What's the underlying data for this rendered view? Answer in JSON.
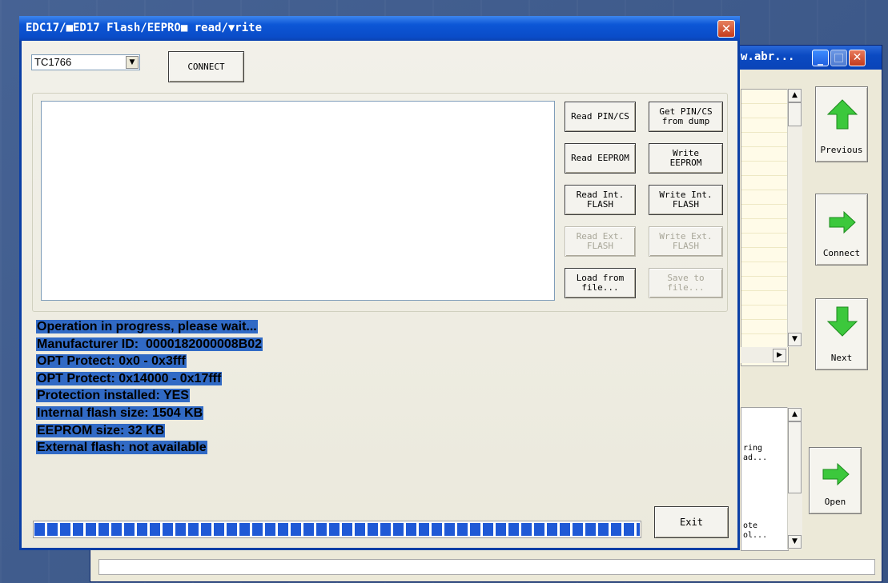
{
  "dialog": {
    "title": "EDC17/■ED17 Flash/EEPRO■ read/▼rite",
    "close_glyph": "✕",
    "chip_select": {
      "value": "TC1766",
      "arrow": "▼"
    },
    "connect_label": "CONNECT",
    "buttons": {
      "read_pin": "Read PIN/CS",
      "get_pin_dump": "Get PIN/CS\nfrom dump",
      "read_eeprom": "Read EEPROM",
      "write_eeprom": "Write\nEEPROM",
      "read_int_flash": "Read Int.\nFLASH",
      "write_int_flash": "Write Int.\nFLASH",
      "read_ext_flash": "Read Ext.\nFLASH",
      "write_ext_flash": "Write Ext.\nFLASH",
      "load_file": "Load from\nfile...",
      "save_file": "Save to\nfile..."
    },
    "status_lines": [
      "Operation in progress, please wait...",
      "Manufacturer ID:  0000182000008B02",
      "OPT Protect: 0x0 - 0x3fff",
      "OPT Protect: 0x14000 - 0x17fff",
      "Protection installed: YES",
      "Internal flash size: 1504 KB",
      "EEPROM size: 32 KB",
      "External flash: not available"
    ],
    "progress": 1.0,
    "exit_label": "Exit"
  },
  "back_window": {
    "title_fragment": "w.abr...",
    "min_glyph": "_",
    "max_glyph": "□",
    "close_glyph": "✕",
    "previous_label": "Previous",
    "connect_label": "Connect",
    "next_label": "Next",
    "open_label": "Open",
    "list2_items": [
      "ring\nad...",
      "ote\nol..."
    ],
    "scroll_up": "▲",
    "scroll_down": "▼",
    "scroll_right": "▶"
  },
  "colors": {
    "accent": "#316ac5",
    "arrow_green": "#3cc83c",
    "titlebar_blue": "#0a4cc8"
  }
}
